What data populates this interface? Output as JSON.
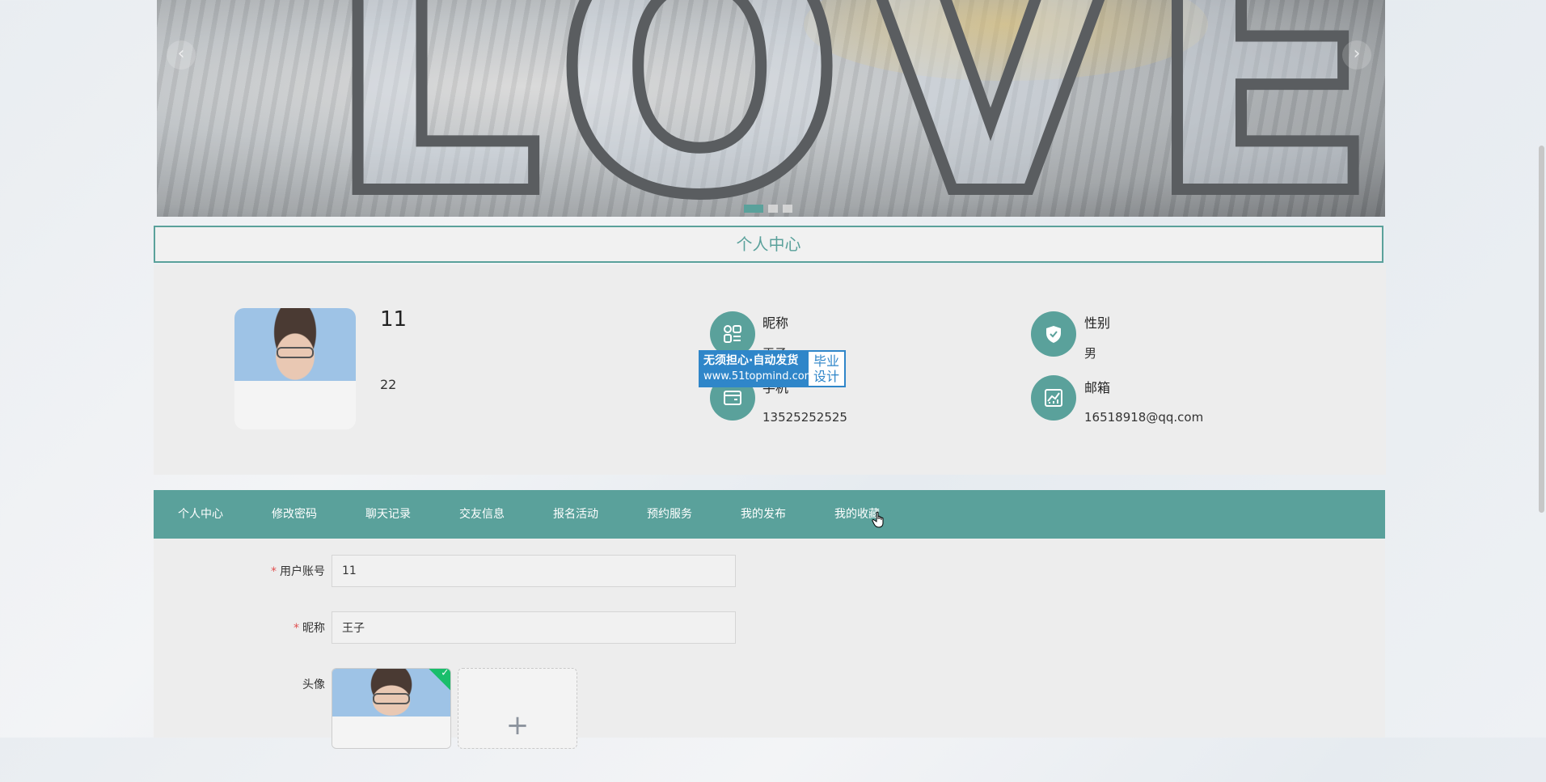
{
  "banner": {
    "image_text": "LOVE",
    "prev_icon": "chevron-left-icon",
    "next_icon": "chevron-right-icon",
    "prev_glyph": "‹",
    "next_glyph": "›",
    "slides": 3,
    "active_slide": 1,
    "accent": "#5aa19b"
  },
  "section": {
    "title": "个人中心"
  },
  "profile": {
    "username": "11",
    "age": "22",
    "nickname_label": "昵称",
    "nickname_value": "王子",
    "phone_label": "手机",
    "phone_value": "13525252525",
    "gender_label": "性别",
    "gender_value": "男",
    "email_label": "邮箱",
    "email_value": "16518918@qq.com"
  },
  "watermark": {
    "line1": "无须担心·自动发货",
    "line2": "www.51topmind.com",
    "right1": "毕业",
    "right2": "设计"
  },
  "tabs": [
    {
      "label": "个人中心"
    },
    {
      "label": "修改密码"
    },
    {
      "label": "聊天记录"
    },
    {
      "label": "交友信息"
    },
    {
      "label": "报名活动"
    },
    {
      "label": "预约服务"
    },
    {
      "label": "我的发布"
    },
    {
      "label": "我的收藏"
    }
  ],
  "form": {
    "account_label": "用户账号",
    "account_value": "11",
    "nickname_label": "昵称",
    "nickname_value": "王子",
    "avatar_label": "头像",
    "required_mark": "*",
    "add_glyph": "+",
    "check_glyph": "✓"
  },
  "colors": {
    "primary": "#5aa19b",
    "required": "#e05050",
    "success": "#19be6b"
  }
}
